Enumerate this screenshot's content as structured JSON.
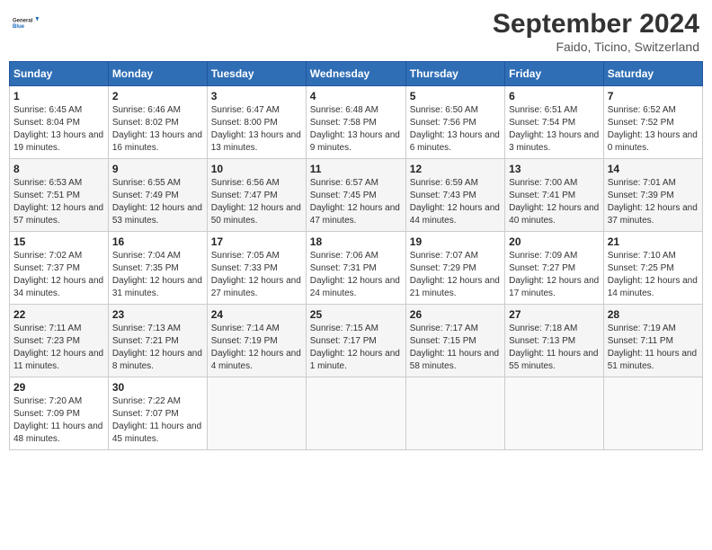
{
  "logo": {
    "general": "General",
    "blue": "Blue"
  },
  "title": "September 2024",
  "subtitle": "Faido, Ticino, Switzerland",
  "headers": [
    "Sunday",
    "Monday",
    "Tuesday",
    "Wednesday",
    "Thursday",
    "Friday",
    "Saturday"
  ],
  "weeks": [
    [
      {
        "day": "1",
        "sunrise": "Sunrise: 6:45 AM",
        "sunset": "Sunset: 8:04 PM",
        "daylight": "Daylight: 13 hours and 19 minutes."
      },
      {
        "day": "2",
        "sunrise": "Sunrise: 6:46 AM",
        "sunset": "Sunset: 8:02 PM",
        "daylight": "Daylight: 13 hours and 16 minutes."
      },
      {
        "day": "3",
        "sunrise": "Sunrise: 6:47 AM",
        "sunset": "Sunset: 8:00 PM",
        "daylight": "Daylight: 13 hours and 13 minutes."
      },
      {
        "day": "4",
        "sunrise": "Sunrise: 6:48 AM",
        "sunset": "Sunset: 7:58 PM",
        "daylight": "Daylight: 13 hours and 9 minutes."
      },
      {
        "day": "5",
        "sunrise": "Sunrise: 6:50 AM",
        "sunset": "Sunset: 7:56 PM",
        "daylight": "Daylight: 13 hours and 6 minutes."
      },
      {
        "day": "6",
        "sunrise": "Sunrise: 6:51 AM",
        "sunset": "Sunset: 7:54 PM",
        "daylight": "Daylight: 13 hours and 3 minutes."
      },
      {
        "day": "7",
        "sunrise": "Sunrise: 6:52 AM",
        "sunset": "Sunset: 7:52 PM",
        "daylight": "Daylight: 13 hours and 0 minutes."
      }
    ],
    [
      {
        "day": "8",
        "sunrise": "Sunrise: 6:53 AM",
        "sunset": "Sunset: 7:51 PM",
        "daylight": "Daylight: 12 hours and 57 minutes."
      },
      {
        "day": "9",
        "sunrise": "Sunrise: 6:55 AM",
        "sunset": "Sunset: 7:49 PM",
        "daylight": "Daylight: 12 hours and 53 minutes."
      },
      {
        "day": "10",
        "sunrise": "Sunrise: 6:56 AM",
        "sunset": "Sunset: 7:47 PM",
        "daylight": "Daylight: 12 hours and 50 minutes."
      },
      {
        "day": "11",
        "sunrise": "Sunrise: 6:57 AM",
        "sunset": "Sunset: 7:45 PM",
        "daylight": "Daylight: 12 hours and 47 minutes."
      },
      {
        "day": "12",
        "sunrise": "Sunrise: 6:59 AM",
        "sunset": "Sunset: 7:43 PM",
        "daylight": "Daylight: 12 hours and 44 minutes."
      },
      {
        "day": "13",
        "sunrise": "Sunrise: 7:00 AM",
        "sunset": "Sunset: 7:41 PM",
        "daylight": "Daylight: 12 hours and 40 minutes."
      },
      {
        "day": "14",
        "sunrise": "Sunrise: 7:01 AM",
        "sunset": "Sunset: 7:39 PM",
        "daylight": "Daylight: 12 hours and 37 minutes."
      }
    ],
    [
      {
        "day": "15",
        "sunrise": "Sunrise: 7:02 AM",
        "sunset": "Sunset: 7:37 PM",
        "daylight": "Daylight: 12 hours and 34 minutes."
      },
      {
        "day": "16",
        "sunrise": "Sunrise: 7:04 AM",
        "sunset": "Sunset: 7:35 PM",
        "daylight": "Daylight: 12 hours and 31 minutes."
      },
      {
        "day": "17",
        "sunrise": "Sunrise: 7:05 AM",
        "sunset": "Sunset: 7:33 PM",
        "daylight": "Daylight: 12 hours and 27 minutes."
      },
      {
        "day": "18",
        "sunrise": "Sunrise: 7:06 AM",
        "sunset": "Sunset: 7:31 PM",
        "daylight": "Daylight: 12 hours and 24 minutes."
      },
      {
        "day": "19",
        "sunrise": "Sunrise: 7:07 AM",
        "sunset": "Sunset: 7:29 PM",
        "daylight": "Daylight: 12 hours and 21 minutes."
      },
      {
        "day": "20",
        "sunrise": "Sunrise: 7:09 AM",
        "sunset": "Sunset: 7:27 PM",
        "daylight": "Daylight: 12 hours and 17 minutes."
      },
      {
        "day": "21",
        "sunrise": "Sunrise: 7:10 AM",
        "sunset": "Sunset: 7:25 PM",
        "daylight": "Daylight: 12 hours and 14 minutes."
      }
    ],
    [
      {
        "day": "22",
        "sunrise": "Sunrise: 7:11 AM",
        "sunset": "Sunset: 7:23 PM",
        "daylight": "Daylight: 12 hours and 11 minutes."
      },
      {
        "day": "23",
        "sunrise": "Sunrise: 7:13 AM",
        "sunset": "Sunset: 7:21 PM",
        "daylight": "Daylight: 12 hours and 8 minutes."
      },
      {
        "day": "24",
        "sunrise": "Sunrise: 7:14 AM",
        "sunset": "Sunset: 7:19 PM",
        "daylight": "Daylight: 12 hours and 4 minutes."
      },
      {
        "day": "25",
        "sunrise": "Sunrise: 7:15 AM",
        "sunset": "Sunset: 7:17 PM",
        "daylight": "Daylight: 12 hours and 1 minute."
      },
      {
        "day": "26",
        "sunrise": "Sunrise: 7:17 AM",
        "sunset": "Sunset: 7:15 PM",
        "daylight": "Daylight: 11 hours and 58 minutes."
      },
      {
        "day": "27",
        "sunrise": "Sunrise: 7:18 AM",
        "sunset": "Sunset: 7:13 PM",
        "daylight": "Daylight: 11 hours and 55 minutes."
      },
      {
        "day": "28",
        "sunrise": "Sunrise: 7:19 AM",
        "sunset": "Sunset: 7:11 PM",
        "daylight": "Daylight: 11 hours and 51 minutes."
      }
    ],
    [
      {
        "day": "29",
        "sunrise": "Sunrise: 7:20 AM",
        "sunset": "Sunset: 7:09 PM",
        "daylight": "Daylight: 11 hours and 48 minutes."
      },
      {
        "day": "30",
        "sunrise": "Sunrise: 7:22 AM",
        "sunset": "Sunset: 7:07 PM",
        "daylight": "Daylight: 11 hours and 45 minutes."
      },
      null,
      null,
      null,
      null,
      null
    ]
  ]
}
